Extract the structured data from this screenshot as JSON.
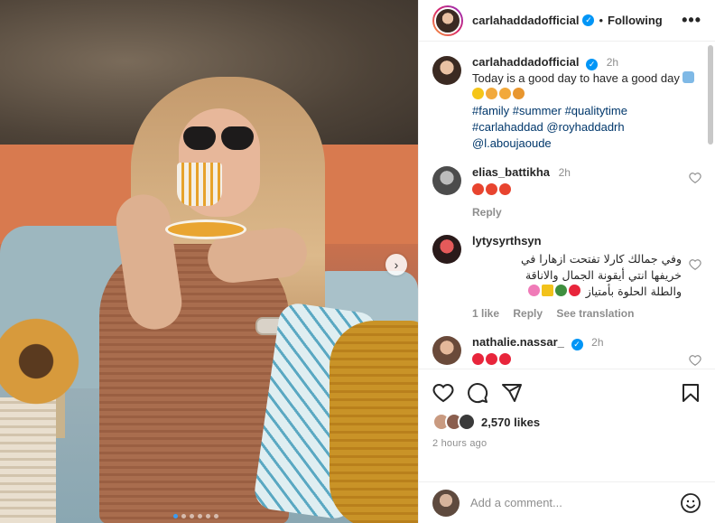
{
  "post": {
    "username": "carlahaddadofficial",
    "follow_status": "Following",
    "more_label": "•••",
    "carousel": {
      "slides": 6,
      "active_slide": 1
    },
    "caption": {
      "time": "2h",
      "text": "Today is a good day to have a good day",
      "hashtags": "#family #summer #qualitytime",
      "line2_prefix": "#carlahaddad",
      "mention1": "@royhaddadrh",
      "mention2": "@l.aboujaoude"
    },
    "comments": [
      {
        "username": "elias_battikha",
        "time": "2h",
        "reply_label": "Reply"
      },
      {
        "username": "lytysyrthsyn",
        "text_line1": "وفي جمالك كارلا تفتحت ازهارا في",
        "text_line2": "خريفها انتي أيقونة الجمال والاناقة",
        "text_line3": "والطلة الحلوة بأمتياز",
        "likes_label": "1 like",
        "reply_label": "Reply",
        "translate_label": "See translation"
      },
      {
        "username": "nathalie.nassar_",
        "time": "2h"
      }
    ],
    "likes": "2,570 likes",
    "posted_ago": "2 hours ago",
    "comment_placeholder": "Add a comment..."
  },
  "colors": {
    "verified": "#0095f6",
    "link": "#00376b",
    "muted": "#8e8e8e"
  },
  "icons": [
    "verified-icon",
    "heart-icon",
    "comment-icon",
    "share-icon",
    "save-icon",
    "emoji-icon",
    "chevron-right-icon"
  ]
}
